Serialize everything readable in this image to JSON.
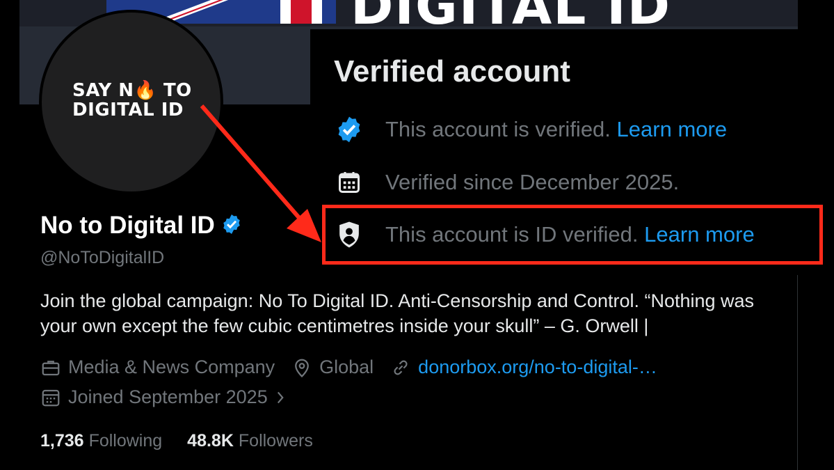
{
  "banner": {
    "text": "DIGITAL ID"
  },
  "avatar": {
    "line1_a": "SAY N",
    "line1_b": "TO",
    "line2": "DIGITAL ID"
  },
  "popup": {
    "title": "Verified account",
    "rows": [
      {
        "text": "This account is verified.",
        "link": "Learn more",
        "icon": "verified-badge-icon"
      },
      {
        "text": "Verified since December 2025.",
        "icon": "calendar-icon"
      },
      {
        "text": "This account is ID verified.",
        "link": "Learn more",
        "icon": "id-shield-icon"
      }
    ]
  },
  "profile": {
    "name": "No to Digital ID",
    "handle": "@NoToDigitalID",
    "bio": "Join the global campaign: No To Digital ID. Anti-Censorship and Control. “Nothing was your own except the few cubic centimetres inside your skull” – G. Orwell |",
    "category": "Media & News Company",
    "location": "Global",
    "website": "donorbox.org/no-to-digital-…",
    "joined": "Joined September 2025",
    "following_count": "1,736",
    "following_label": "Following",
    "followers_count": "48.8K",
    "followers_label": "Followers"
  },
  "colors": {
    "accent": "#1d9bf0",
    "highlight": "#ff2a1a",
    "muted": "#71767b"
  }
}
